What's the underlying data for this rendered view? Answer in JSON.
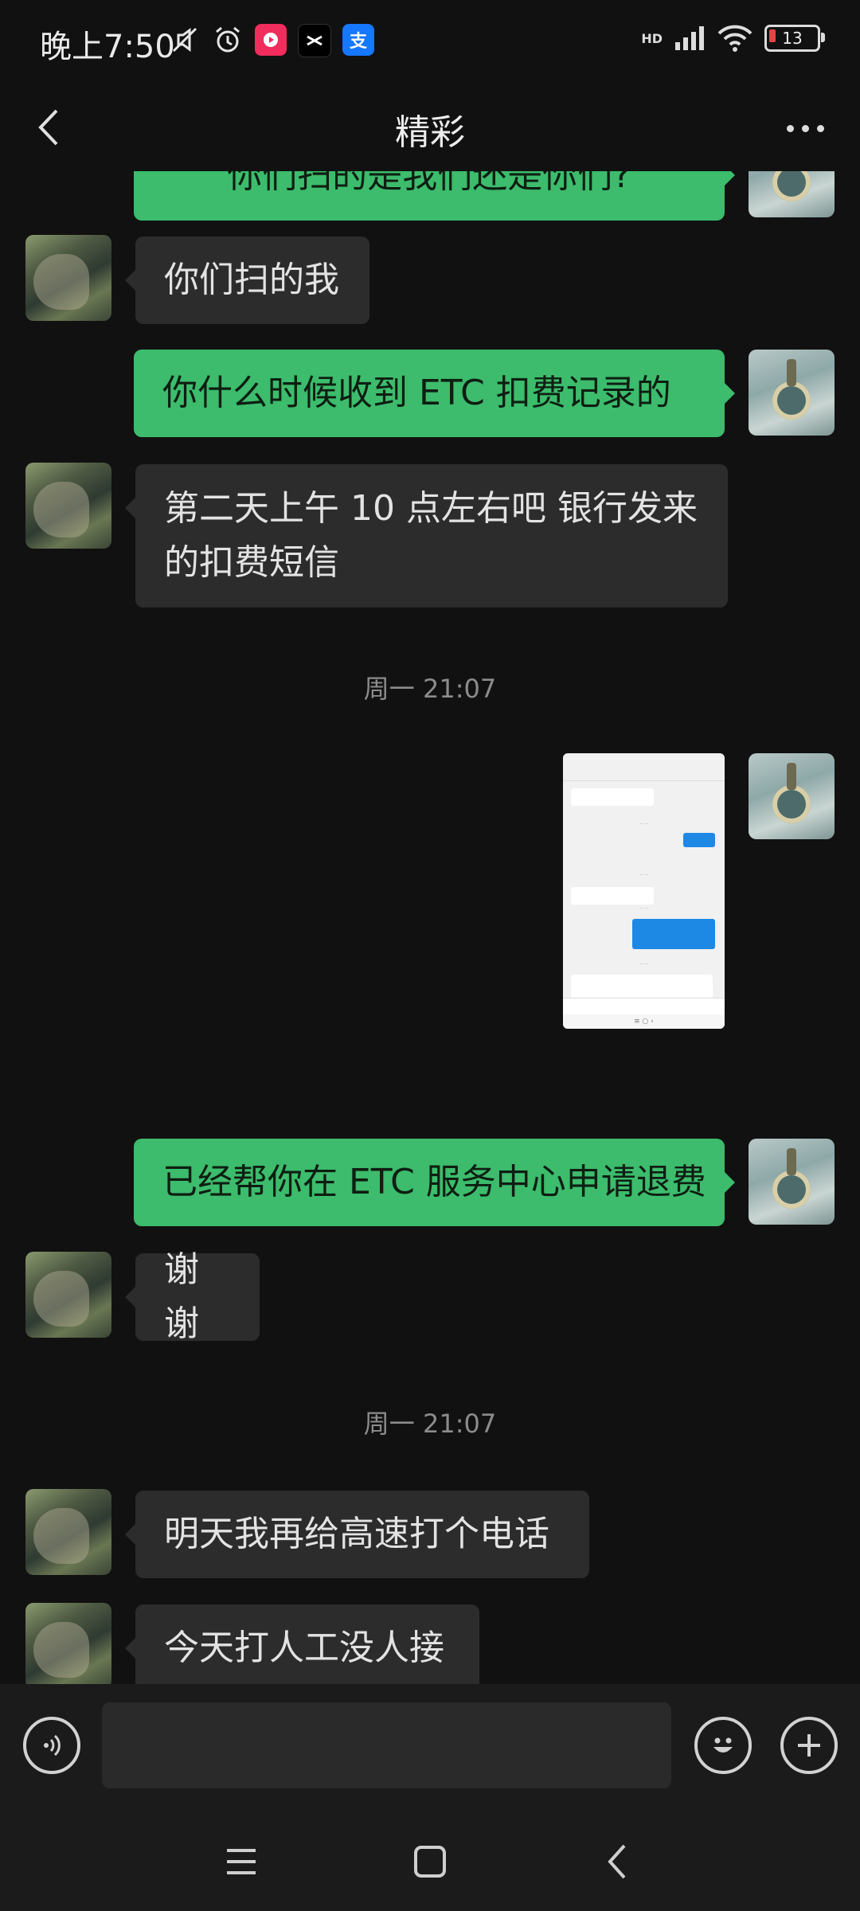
{
  "status_bar": {
    "time": "晚上7:50",
    "network": "HD",
    "battery": "13",
    "icons": [
      "mute-icon",
      "alarm-icon",
      "video-app-icon",
      "capcut-icon",
      "alipay-icon",
      "signal-icon",
      "wifi-icon",
      "battery-icon"
    ]
  },
  "header": {
    "title": "精彩",
    "back_icon": "chevron-left-icon",
    "more_icon": "more-dots-icon"
  },
  "messages": [
    {
      "side": "right",
      "type": "text",
      "text": "你们扫的是我们还是你们?"
    },
    {
      "side": "left",
      "type": "text",
      "text": "你们扫的我"
    },
    {
      "side": "right",
      "type": "text",
      "text": "你什么时候收到 ETC 扣费记录的"
    },
    {
      "side": "left",
      "type": "text",
      "text": "第二天上午 10 点左右吧 银行发来的扣费短信"
    },
    {
      "type": "timestamp",
      "text": "周一 21:07"
    },
    {
      "side": "right",
      "type": "image",
      "description": "chat-screenshot"
    },
    {
      "side": "right",
      "type": "text",
      "text": "已经帮你在 ETC 服务中心申请退费"
    },
    {
      "side": "left",
      "type": "text",
      "text": "谢谢"
    },
    {
      "type": "timestamp",
      "text": "周一 21:07"
    },
    {
      "side": "left",
      "type": "text",
      "text": "明天我再给高速打个电话"
    },
    {
      "side": "left",
      "type": "text",
      "text": "今天打人工没人接"
    }
  ],
  "input_bar": {
    "voice_icon": "voice-icon",
    "text_value": "",
    "emoji_icon": "emoji-icon",
    "plus_icon": "plus-icon"
  },
  "nav_bar": {
    "icons": [
      "menu-icon",
      "home-icon",
      "back-icon"
    ]
  },
  "colors": {
    "background": "#111111",
    "bubble_left": "#2c2c2c",
    "bubble_right": "#3cbc6c",
    "timestamp": "#8c8c8c"
  }
}
